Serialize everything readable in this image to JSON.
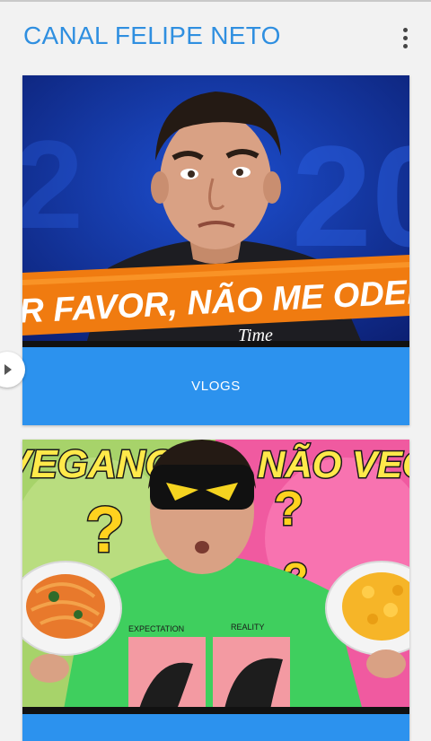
{
  "app": {
    "title": "CANAL FELIPE NETO"
  },
  "cards": [
    {
      "thumbnail_text": "R FAVOR, NÃO ME ODEI",
      "shirt_text": "Time",
      "button_label": "VLOGS"
    },
    {
      "thumbnail_left_text": "VEGANO",
      "thumbnail_right_text": "NÃO VEGA",
      "shirt_left_text": "EXPECTATION",
      "shirt_right_text": "REALITY",
      "button_label": ""
    }
  ],
  "icons": {
    "menu": "more-vertical-icon",
    "side_handle": "chevron-right-icon"
  },
  "colors": {
    "title": "#2f8fe0",
    "button": "#2c92ee"
  }
}
